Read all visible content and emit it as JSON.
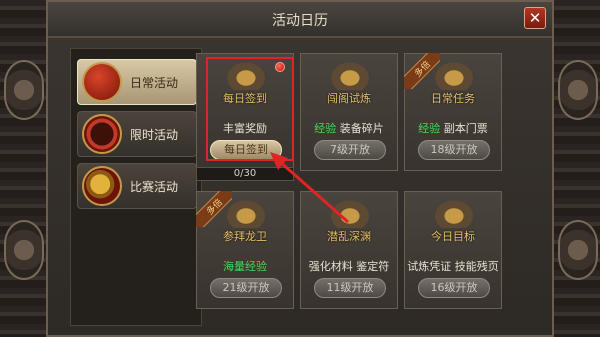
{
  "window": {
    "title": "活动日历"
  },
  "sidebar": {
    "items": [
      {
        "label": "日常活动",
        "icon": "calendar-icon",
        "active": true
      },
      {
        "label": "限时活动",
        "icon": "clock-icon",
        "active": false
      },
      {
        "label": "比赛活动",
        "icon": "gong-icon",
        "active": false
      }
    ]
  },
  "progress": {
    "text": "0/30",
    "value": 0,
    "max": 30
  },
  "cards": [
    {
      "name": "每日签到",
      "reward": "丰富奖励",
      "button": "每日签到",
      "enabled": true,
      "ribbon": "",
      "red_dot": true
    },
    {
      "name": "闯阁试炼",
      "reward_green": "经验",
      "reward": "装备碎片",
      "button": "7级开放",
      "enabled": false,
      "ribbon": ""
    },
    {
      "name": "日常任务",
      "reward_green": "经验",
      "reward": "副本门票",
      "button": "18级开放",
      "enabled": false,
      "ribbon": "多倍"
    },
    {
      "name": "参拜龙卫",
      "reward_green": "海量经验",
      "reward": "",
      "button": "21级开放",
      "enabled": false,
      "ribbon": "多倍"
    },
    {
      "name": "潜乱深渊",
      "reward": "强化材料 鉴定符",
      "button": "11级开放",
      "enabled": false,
      "ribbon": ""
    },
    {
      "name": "今日目标",
      "reward": "试炼凭证 技能残页",
      "button": "16级开放",
      "enabled": false,
      "ribbon": ""
    }
  ],
  "colors": {
    "highlight": "#e02323",
    "arrow": "#e02323",
    "green_text": "#45d65a"
  }
}
